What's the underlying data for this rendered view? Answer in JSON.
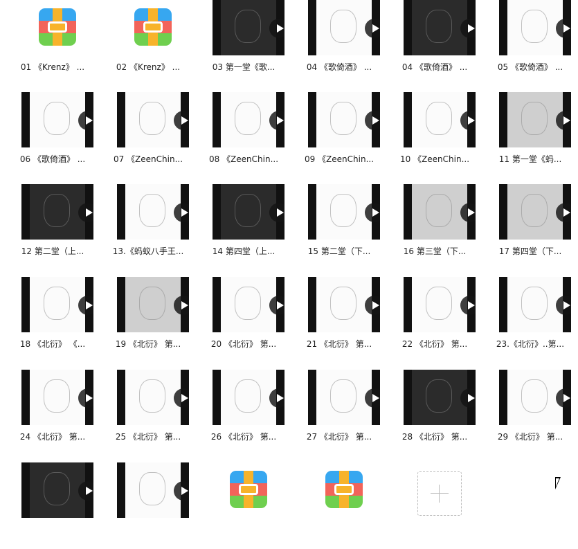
{
  "items": [
    {
      "label": "01 《Krenz》 ...",
      "kind": "app"
    },
    {
      "label": "02 《Krenz》 ...",
      "kind": "app"
    },
    {
      "label": "03 第一堂《歌...",
      "kind": "video",
      "tone": "dark"
    },
    {
      "label": "04 《歌倚酒》 ...",
      "kind": "video",
      "tone": "white"
    },
    {
      "label": "04 《歌倚酒》 ...",
      "kind": "video",
      "tone": "dark"
    },
    {
      "label": "05 《歌倚酒》 ...",
      "kind": "video",
      "tone": "white"
    },
    {
      "label": "06 《歌倚酒》 ...",
      "kind": "video",
      "tone": "white"
    },
    {
      "label": "07 《ZeenChin...",
      "kind": "video",
      "tone": "white"
    },
    {
      "label": "08 《ZeenChin...",
      "kind": "video",
      "tone": "white"
    },
    {
      "label": "09 《ZeenChin...",
      "kind": "video",
      "tone": "white"
    },
    {
      "label": "10 《ZeenChin...",
      "kind": "video",
      "tone": "white"
    },
    {
      "label": "11 第一堂《蚂...",
      "kind": "video",
      "tone": "gray"
    },
    {
      "label": "12 第二堂（上...",
      "kind": "video",
      "tone": "dark"
    },
    {
      "label": "13.《蚂蚁八手王...",
      "kind": "video",
      "tone": "white"
    },
    {
      "label": "14 第四堂（上...",
      "kind": "video",
      "tone": "dark"
    },
    {
      "label": "15 第二堂（下...",
      "kind": "video",
      "tone": "white"
    },
    {
      "label": "16 第三堂（下...",
      "kind": "video",
      "tone": "gray"
    },
    {
      "label": "17 第四堂（下...",
      "kind": "video",
      "tone": "gray"
    },
    {
      "label": "18 《北衍》 《...",
      "kind": "video",
      "tone": "white"
    },
    {
      "label": "19 《北衍》 第...",
      "kind": "video",
      "tone": "gray"
    },
    {
      "label": "20 《北衍》 第...",
      "kind": "video",
      "tone": "white"
    },
    {
      "label": "21 《北衍》 第...",
      "kind": "video",
      "tone": "white"
    },
    {
      "label": "22 《北衍》 第...",
      "kind": "video",
      "tone": "white"
    },
    {
      "label": "23.《北衍》..第...",
      "kind": "video",
      "tone": "white"
    },
    {
      "label": "24 《北衍》 第...",
      "kind": "video",
      "tone": "white"
    },
    {
      "label": "25 《北衍》 第...",
      "kind": "video",
      "tone": "white"
    },
    {
      "label": "26 《北衍》 第...",
      "kind": "video",
      "tone": "white"
    },
    {
      "label": "27 《北衍》 第...",
      "kind": "video",
      "tone": "white"
    },
    {
      "label": "28 《北衍》 第...",
      "kind": "video",
      "tone": "dark"
    },
    {
      "label": "29 《北衍》 第...",
      "kind": "video",
      "tone": "white"
    },
    {
      "label": "",
      "kind": "video",
      "tone": "dark"
    },
    {
      "label": "",
      "kind": "video",
      "tone": "white"
    },
    {
      "label": "",
      "kind": "app"
    },
    {
      "label": "",
      "kind": "app"
    }
  ],
  "icons": {
    "app": "archive-app-icon",
    "play": "play-icon",
    "add": "plus-icon",
    "cursor": "mouse-cursor-icon"
  }
}
